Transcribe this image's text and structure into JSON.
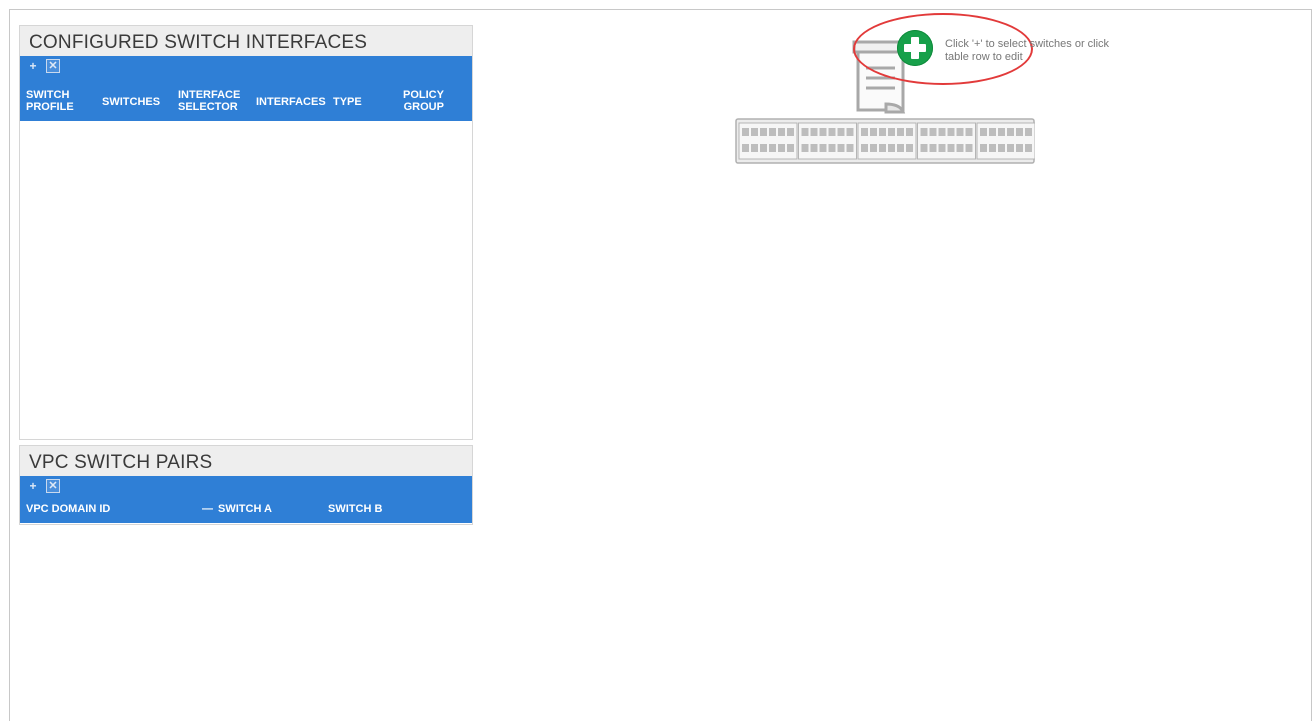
{
  "configured_panel": {
    "title": "CONFIGURED SWITCH INTERFACES",
    "add_icon": "+",
    "delete_icon": "✕",
    "columns": [
      {
        "line1": "SWITCH",
        "line2": "PROFILE"
      },
      {
        "line1": "SWITCHES",
        "line2": ""
      },
      {
        "line1": "INTERFACE",
        "line2": "SELECTOR"
      },
      {
        "line1": "INTERFACES",
        "line2": ""
      },
      {
        "line1": "TYPE",
        "line2": ""
      },
      {
        "line1": "POLICY",
        "line2": "GROUP"
      }
    ]
  },
  "vpc_panel": {
    "title": "VPC SWITCH PAIRS",
    "add_icon": "+",
    "delete_icon": "✕",
    "columns": [
      "VPC DOMAIN ID",
      "SWITCH A",
      "SWITCH B"
    ],
    "dash": "—"
  },
  "hint": {
    "line1": "Click '+' to select switches or click",
    "line2": "table row to edit"
  },
  "colors": {
    "header_blue": "#2f7fd6",
    "add_green": "#17a04a",
    "annotation_red": "#e23a3a"
  },
  "icons": {
    "document": "document-icon",
    "switch": "switch-chassis-icon",
    "add": "plus-circle-icon"
  }
}
